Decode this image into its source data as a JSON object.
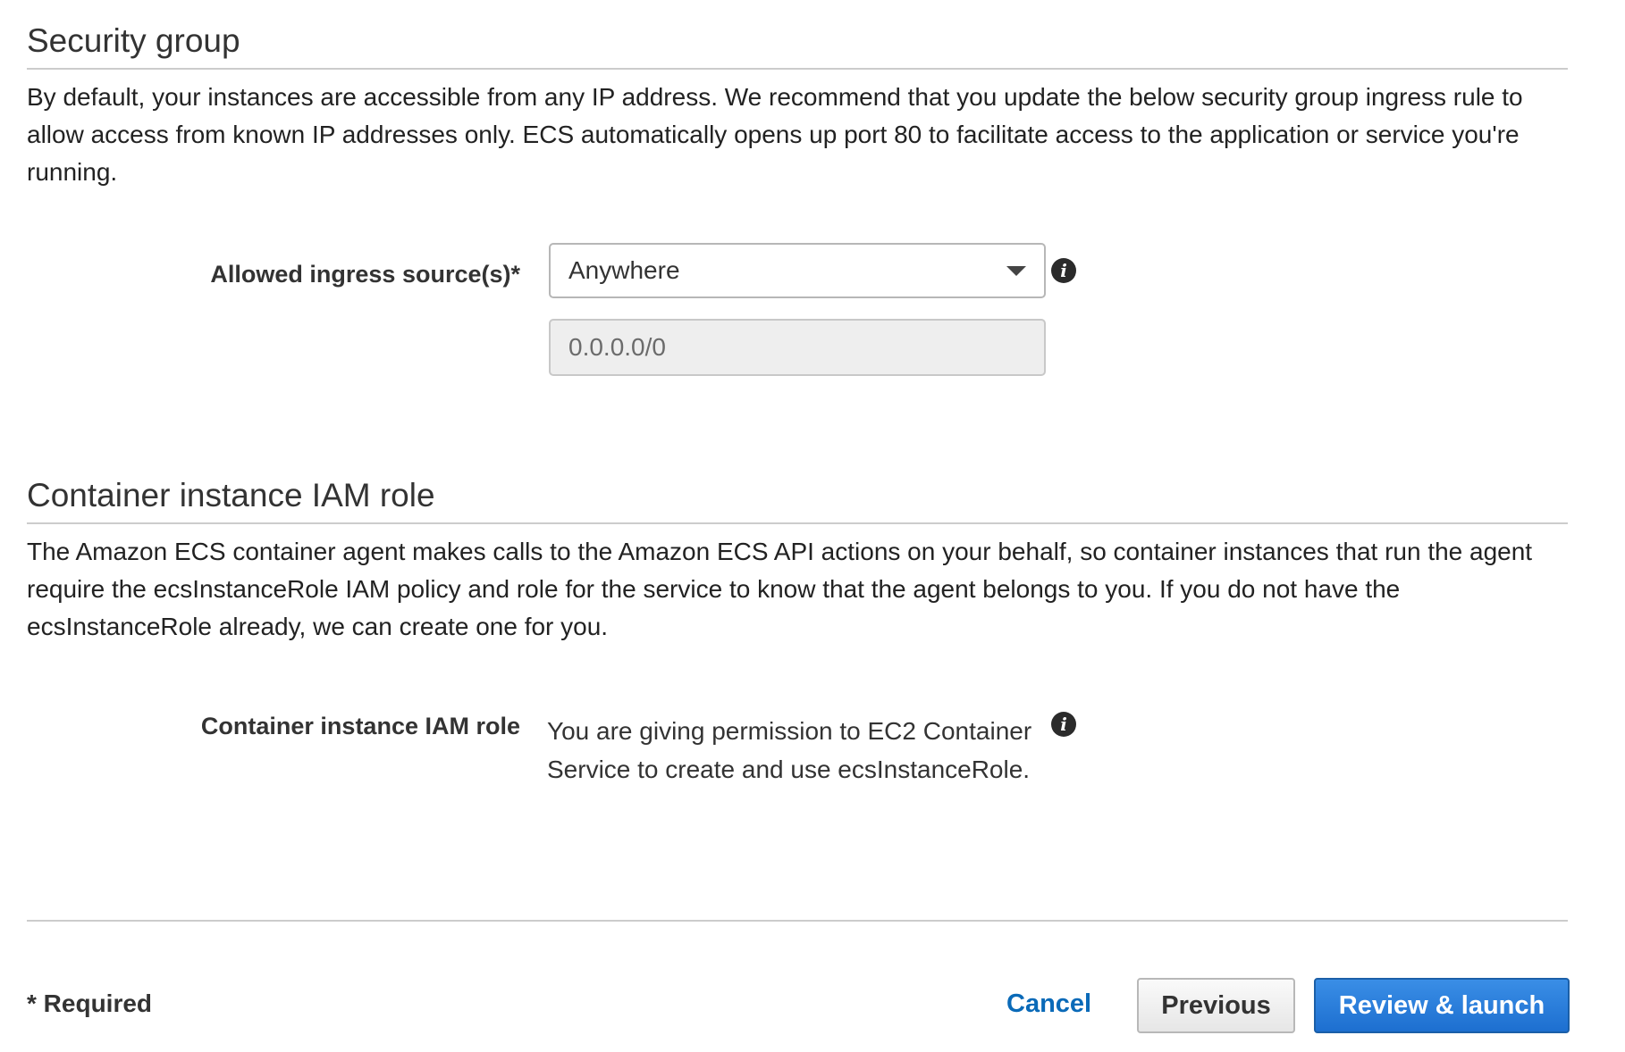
{
  "security_group": {
    "title": "Security group",
    "description": "By default, your instances are accessible from any IP address. We recommend that you update the below security group ingress rule to allow access from known IP addresses only. ECS automatically opens up port 80 to facilitate access to the application or service you're running.",
    "ingress_label": "Allowed ingress source(s)*",
    "ingress_selected": "Anywhere",
    "cidr_value": "0.0.0.0/0",
    "info_icon": "info-icon"
  },
  "iam_role": {
    "title": "Container instance IAM role",
    "description": "The Amazon ECS container agent makes calls to the Amazon ECS API actions on your behalf, so container instances that run the agent require the ecsInstanceRole IAM policy and role for the service to know that the agent belongs to you. If you do not have the ecsInstanceRole already, we can create one for you.",
    "role_label": "Container instance IAM role",
    "role_text": "You are giving permission to EC2 Container Service to create and use ecsInstanceRole.",
    "info_icon": "info-icon"
  },
  "footer": {
    "required_note": "* Required",
    "cancel_label": "Cancel",
    "previous_label": "Previous",
    "primary_label": "Review & launch"
  },
  "colors": {
    "link": "#0a6ab8",
    "primary_button": "#1d6fd0",
    "rule": "#cccccc"
  }
}
